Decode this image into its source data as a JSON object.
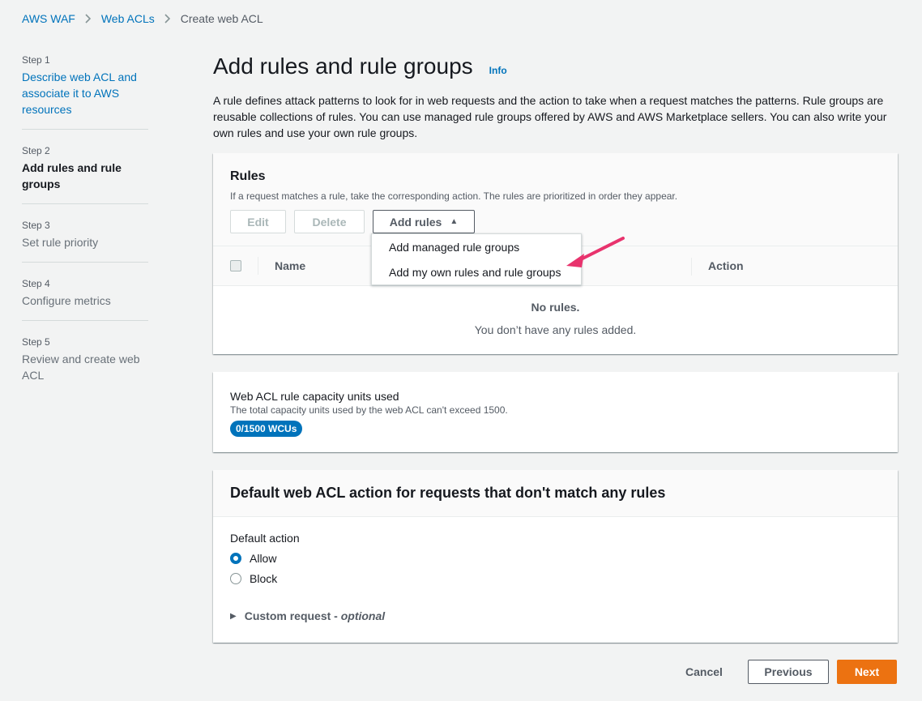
{
  "breadcrumb": {
    "items": [
      "AWS WAF",
      "Web ACLs"
    ],
    "current": "Create web ACL"
  },
  "steps": [
    {
      "num": "Step 1",
      "label": "Describe web ACL and associate it to AWS resources",
      "state": "link"
    },
    {
      "num": "Step 2",
      "label": "Add rules and rule groups",
      "state": "active"
    },
    {
      "num": "Step 3",
      "label": "Set rule priority",
      "state": "muted"
    },
    {
      "num": "Step 4",
      "label": "Configure metrics",
      "state": "muted"
    },
    {
      "num": "Step 5",
      "label": "Review and create web ACL",
      "state": "muted"
    }
  ],
  "header": {
    "title": "Add rules and rule groups",
    "info": "Info",
    "description": "A rule defines attack patterns to look for in web requests and the action to take when a request matches the patterns. Rule groups are reusable collections of rules. You can use managed rule groups offered by AWS and AWS Marketplace sellers. You can also write your own rules and use your own rule groups."
  },
  "rules": {
    "title": "Rules",
    "subtitle": "If a request matches a rule, take the corresponding action. The rules are prioritized in order they appear.",
    "edit": "Edit",
    "delete": "Delete",
    "add_rules": "Add rules",
    "columns": {
      "name": "Name",
      "action": "Action"
    },
    "empty_title": "No rules.",
    "empty_sub": "You don’t have any rules added.",
    "dropdown": [
      "Add managed rule groups",
      "Add my own rules and rule groups"
    ]
  },
  "wcu": {
    "title": "Web ACL rule capacity units used",
    "subtitle": "The total capacity units used by the web ACL can't exceed 1500.",
    "badge": "0/1500 WCUs"
  },
  "default_action": {
    "title": "Default web ACL action for requests that don't match any rules",
    "label": "Default action",
    "options": [
      "Allow",
      "Block"
    ],
    "selected": "Allow",
    "custom_label": "Custom request - ",
    "custom_optional": "optional"
  },
  "footer": {
    "cancel": "Cancel",
    "previous": "Previous",
    "next": "Next"
  },
  "colors": {
    "link": "#0073bb",
    "primary": "#ec7211",
    "annotation": "#e8336d"
  }
}
